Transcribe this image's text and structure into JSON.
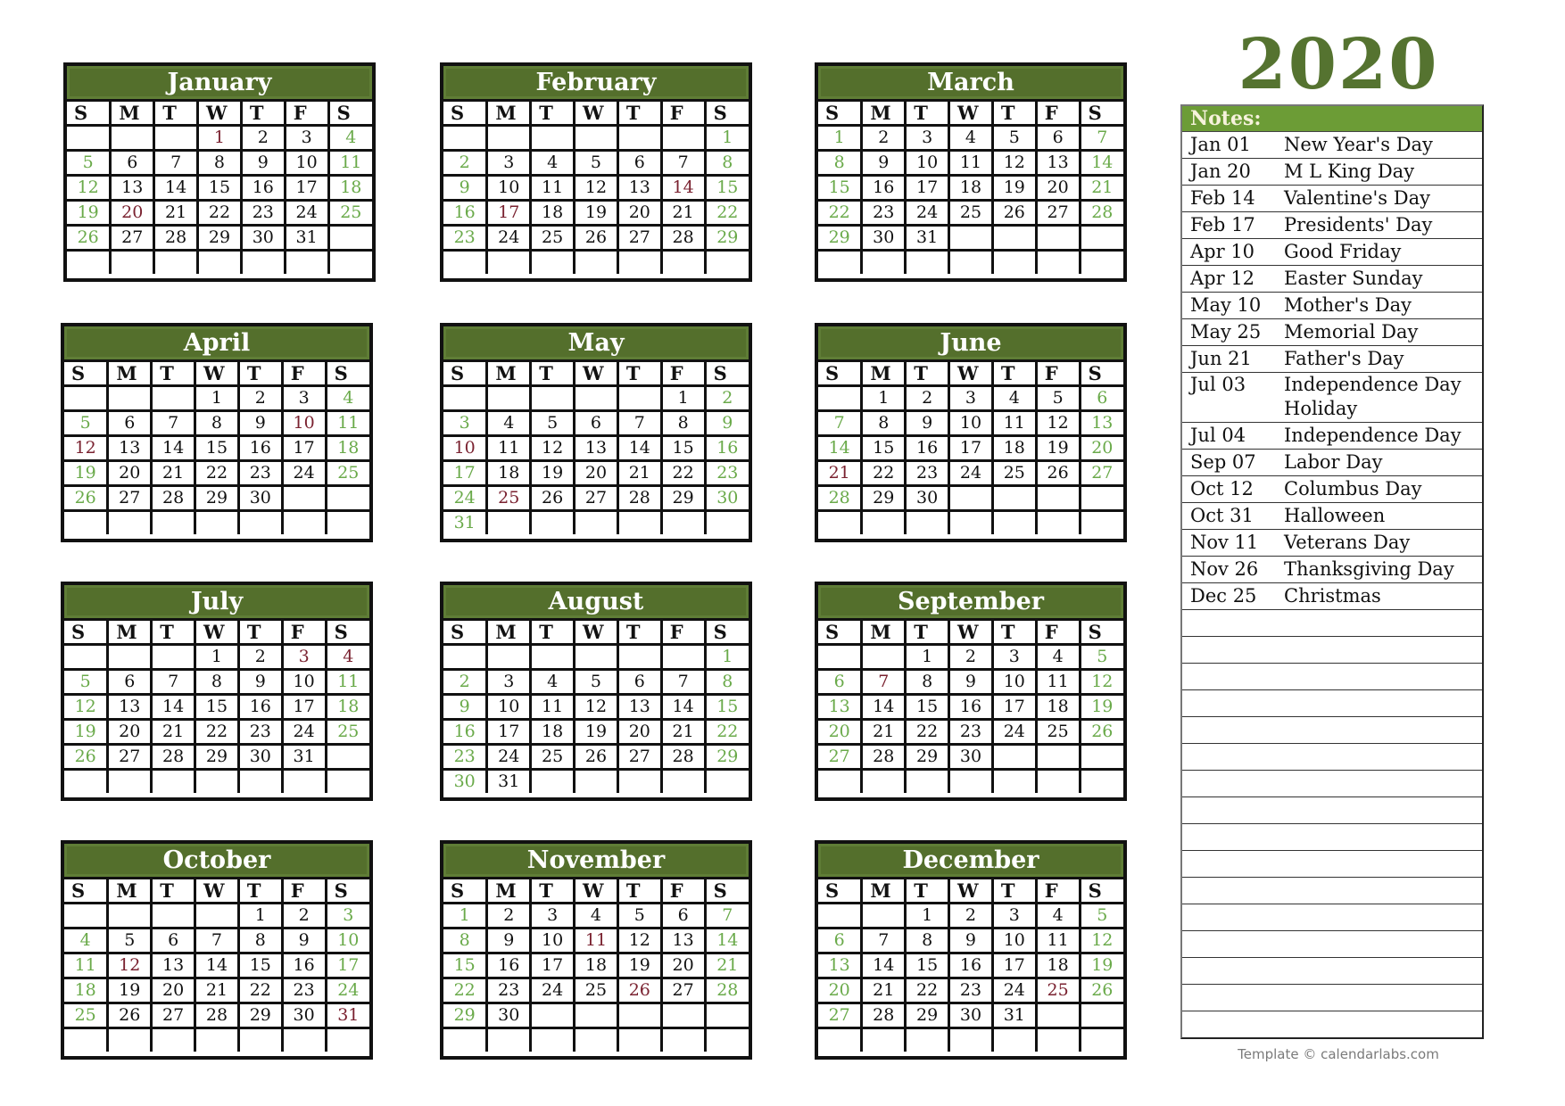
{
  "year": "2020",
  "weekdays": [
    "S",
    "M",
    "T",
    "W",
    "T",
    "F",
    "S"
  ],
  "colors": {
    "month_header": "#546f2c",
    "notes_header": "#6c9c36",
    "year_title": "#557330",
    "weekend": "#6aaa4a",
    "holiday": "#7a2230"
  },
  "months": [
    {
      "name": "January",
      "start": 3,
      "days": 31,
      "holidays": [
        1,
        20
      ]
    },
    {
      "name": "February",
      "start": 6,
      "days": 29,
      "holidays": [
        14,
        17
      ]
    },
    {
      "name": "March",
      "start": 0,
      "days": 31,
      "holidays": []
    },
    {
      "name": "April",
      "start": 3,
      "days": 30,
      "holidays": [
        10,
        12
      ]
    },
    {
      "name": "May",
      "start": 5,
      "days": 31,
      "holidays": [
        10,
        25
      ]
    },
    {
      "name": "June",
      "start": 1,
      "days": 30,
      "holidays": [
        21
      ]
    },
    {
      "name": "July",
      "start": 3,
      "days": 31,
      "holidays": [
        3,
        4
      ]
    },
    {
      "name": "August",
      "start": 6,
      "days": 31,
      "holidays": []
    },
    {
      "name": "September",
      "start": 2,
      "days": 30,
      "holidays": [
        7
      ]
    },
    {
      "name": "October",
      "start": 4,
      "days": 31,
      "holidays": [
        12,
        31
      ]
    },
    {
      "name": "November",
      "start": 0,
      "days": 30,
      "holidays": [
        11,
        26
      ]
    },
    {
      "name": "December",
      "start": 2,
      "days": 31,
      "holidays": [
        25
      ]
    }
  ],
  "notes": {
    "title": "Notes:",
    "items": [
      {
        "date": "Jan 01",
        "name": "New Year's Day"
      },
      {
        "date": "Jan 20",
        "name": "M L King Day"
      },
      {
        "date": "Feb 14",
        "name": "Valentine's Day"
      },
      {
        "date": "Feb 17",
        "name": "Presidents' Day"
      },
      {
        "date": "Apr 10",
        "name": "Good Friday"
      },
      {
        "date": "Apr 12",
        "name": "Easter Sunday"
      },
      {
        "date": "May 10",
        "name": "Mother's Day"
      },
      {
        "date": "May 25",
        "name": "Memorial Day"
      },
      {
        "date": "Jun 21",
        "name": "Father's Day"
      },
      {
        "date": "Jul 03",
        "name": "Independence Day Holiday"
      },
      {
        "date": "Jul 04",
        "name": "Independence Day"
      },
      {
        "date": "Sep 07",
        "name": "Labor Day"
      },
      {
        "date": "Oct 12",
        "name": "Columbus Day"
      },
      {
        "date": "Oct 31",
        "name": "Halloween"
      },
      {
        "date": "Nov 11",
        "name": "Veterans Day"
      },
      {
        "date": "Nov 26",
        "name": "Thanksgiving Day"
      },
      {
        "date": "Dec 25",
        "name": "Christmas"
      }
    ],
    "blank_rows": 16
  },
  "footer": "Template © calendarlabs.com"
}
